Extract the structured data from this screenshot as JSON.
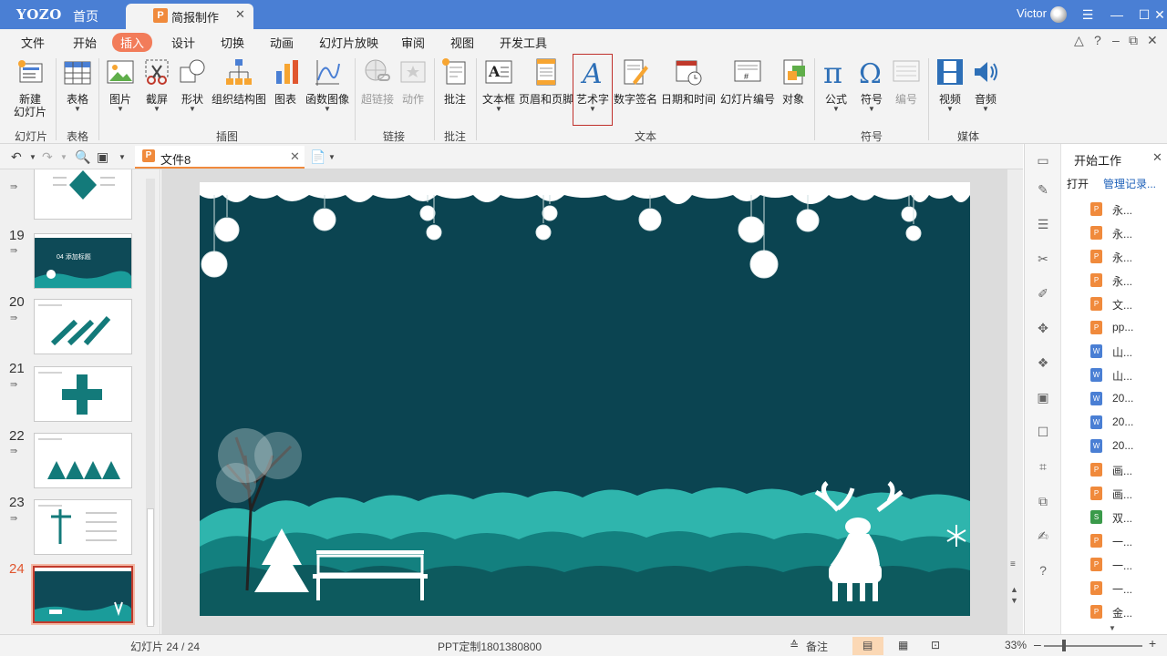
{
  "titlebar": {
    "logo": "YOZO",
    "home_label": "首页",
    "doc_tab_icon": "P",
    "doc_tab_title": "简报制作",
    "user_name": "Victor",
    "accent_color": "#4a7fd4"
  },
  "menu": {
    "items": [
      "文件",
      "开始",
      "插入",
      "设计",
      "切换",
      "动画",
      "幻灯片放映",
      "审阅",
      "视图",
      "开发工具"
    ],
    "active": "插入",
    "active_color": "#f27c5a"
  },
  "ribbon": {
    "buttons": {
      "new_slide_line1": "新建",
      "new_slide_line2": "幻灯片",
      "table": "表格",
      "picture": "图片",
      "screenshot": "截屏",
      "shape": "形状",
      "org_chart": "组织结构图",
      "chart": "图表",
      "function_graph": "函数图像",
      "hyperlink": "超链接",
      "action": "动作",
      "comment": "批注",
      "textbox": "文本框",
      "header_footer": "页眉和页脚",
      "wordart": "艺术字",
      "digital_sign": "数字签名",
      "datetime": "日期和时间",
      "slide_number": "幻灯片编号",
      "object": "对象",
      "formula": "公式",
      "symbol": "符号",
      "numbering": "编号",
      "video": "视频",
      "audio": "音频"
    },
    "groups": [
      "幻灯片",
      "表格",
      "插图",
      "链接",
      "批注",
      "文本",
      "符号",
      "媒体"
    ]
  },
  "quickbar": {
    "file_tab_icon": "P",
    "file_tab": "文件8"
  },
  "thumbnails": {
    "numbers": [
      "19",
      "20",
      "21",
      "22",
      "23",
      "24"
    ],
    "slide19_title": "04 添加标题",
    "selected": "24"
  },
  "right_panel": {
    "title": "开始工作",
    "open": "打开",
    "manage": "管理记录...",
    "files": [
      {
        "name": "永...",
        "type": "p"
      },
      {
        "name": "永...",
        "type": "p"
      },
      {
        "name": "永...",
        "type": "p"
      },
      {
        "name": "永...",
        "type": "p"
      },
      {
        "name": "文...",
        "type": "p"
      },
      {
        "name": "pp...",
        "type": "p"
      },
      {
        "name": "山...",
        "type": "w"
      },
      {
        "name": "山...",
        "type": "w"
      },
      {
        "name": "20...",
        "type": "w"
      },
      {
        "name": "20...",
        "type": "w"
      },
      {
        "name": "20...",
        "type": "w"
      },
      {
        "name": "画...",
        "type": "p"
      },
      {
        "name": "画...",
        "type": "p"
      },
      {
        "name": "双...",
        "type": "x"
      },
      {
        "name": "一...",
        "type": "p"
      },
      {
        "name": "一...",
        "type": "p"
      },
      {
        "name": "一...",
        "type": "p"
      },
      {
        "name": "金...",
        "type": "p"
      }
    ]
  },
  "statusbar": {
    "slide_counter": "幻灯片 24 / 24",
    "template": "PPT定制1801380800",
    "notes": "备注",
    "zoom": "33%"
  },
  "slide": {
    "background": "#0b4451",
    "accent": "#1a9c9a"
  }
}
